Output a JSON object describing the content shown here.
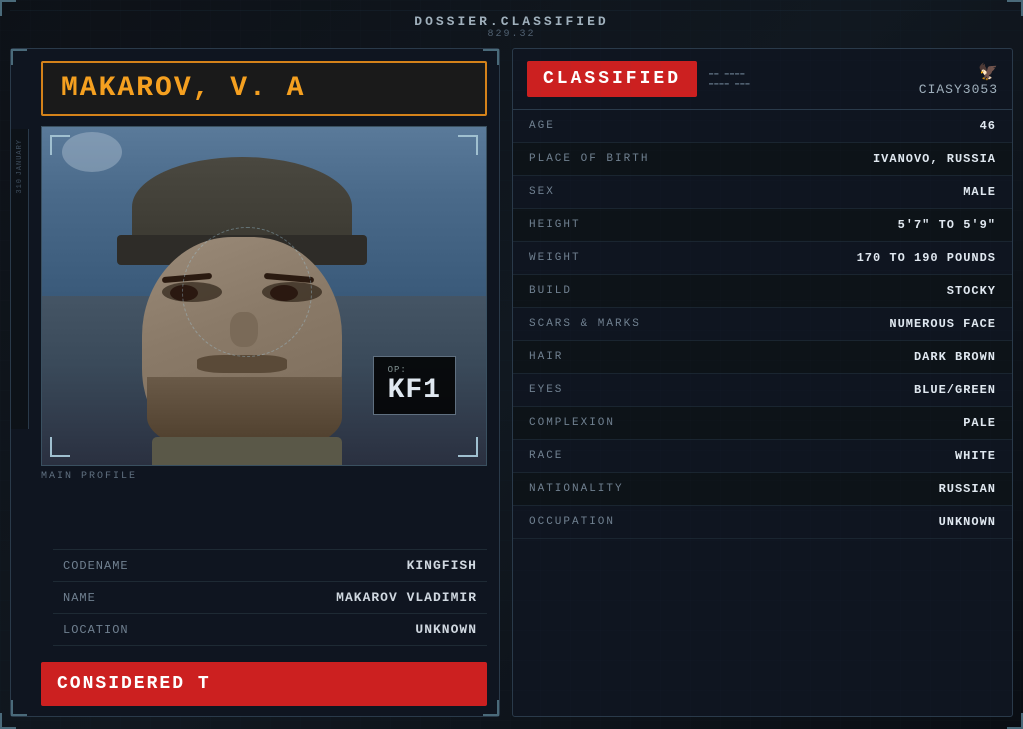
{
  "header": {
    "title": "DOSSIER.CLASSIFIED",
    "subtitle": "829.32"
  },
  "left_panel": {
    "name_banner": "MAKAROV, V. A",
    "photo": {
      "badge_label": "OP:",
      "badge_code": "KF1",
      "profile_label": "MAIN PROFILE"
    },
    "fields": [
      {
        "label": "CODENAME",
        "value": "KINGFISH"
      },
      {
        "label": "NAME",
        "value": "MAKAROV VLADIMIR"
      },
      {
        "label": "LOCATION",
        "value": "UNKNOWN"
      }
    ],
    "status_banner": "CONSIDERED T"
  },
  "right_panel": {
    "classified_label": "CLASSIFIED",
    "cia_eagle": "🦅",
    "cia_code": "CIASY3053",
    "doc_meta": [
      "▬▬ ▬▬▬▬",
      "▬▬▬▬ ▬▬▬"
    ],
    "fields": [
      {
        "label": "AGE",
        "value": "46"
      },
      {
        "label": "PLACE OF BIRTH",
        "value": "IVANOVO, RUSSIA"
      },
      {
        "label": "SEX",
        "value": "MALE"
      },
      {
        "label": "HEIGHT",
        "value": "5'7\" TO 5'9\""
      },
      {
        "label": "WEIGHT",
        "value": "170 TO 190 POUNDS"
      },
      {
        "label": "BUILD",
        "value": "STOCKY"
      },
      {
        "label": "SCARS & MARKS",
        "value": "NUMEROUS FACE"
      },
      {
        "label": "HAIR",
        "value": "DARK BROWN"
      },
      {
        "label": "EYES",
        "value": "BLUE/GREEN"
      },
      {
        "label": "COMPLEXION",
        "value": "PALE"
      },
      {
        "label": "RACE",
        "value": "WHITE"
      },
      {
        "label": "NATIONALITY",
        "value": "RUSSIAN"
      },
      {
        "label": "OCCUPATION",
        "value": "UNKNOWN"
      }
    ]
  }
}
